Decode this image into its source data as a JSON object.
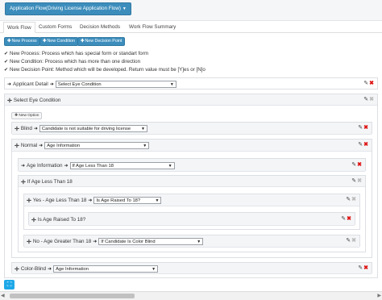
{
  "header": {
    "flow_button": "Application Flow(Driving License Application Flow)"
  },
  "tabs": [
    {
      "label": "Work Flow",
      "active": true
    },
    {
      "label": "Custom Forms",
      "active": false
    },
    {
      "label": "Decision Methods",
      "active": false
    },
    {
      "label": "Work Flow Summary",
      "active": false
    }
  ],
  "actions": {
    "new_process": "New Process",
    "new_condition": "New Condition",
    "new_decision_point": "New Decision Point"
  },
  "notes": [
    "New Process: Process which has special form or standart form",
    "New Condition: Process which has more than one direction",
    "New Decision Point: Method which will be developed. Return value must be [Y]es or [N]o"
  ],
  "flow": {
    "applicant_detail": {
      "label": "Applicant Detail",
      "select": "Select Eye Condition"
    },
    "select_eye_condition": {
      "label": "Select Eye Condition",
      "new_option": "New Option"
    },
    "blind": {
      "label": "Blind",
      "select": "Candidate is not suitable for driving license"
    },
    "normal": {
      "label": "Normal",
      "select": "Age Information"
    },
    "age_information": {
      "label": "Age Information",
      "select": "If Age Less Than 18"
    },
    "if_age_less": {
      "label": "If Age Less Than 18"
    },
    "yes_branch": {
      "label": "Yes - Age Less Than 18",
      "select": "Is Age Raised To 18?"
    },
    "is_age_raised": {
      "label": "Is Age Raised To 18?"
    },
    "no_branch": {
      "label": "No - Age Greater Than 18",
      "select": "If Candidate Is Color Blind"
    },
    "color_blind": {
      "label": "Color-Blind",
      "select": "Age Information"
    }
  },
  "colors": {
    "primary": "#3c8dbc",
    "delete": "#dd1111",
    "fullscreen": "#1fa8e8"
  }
}
